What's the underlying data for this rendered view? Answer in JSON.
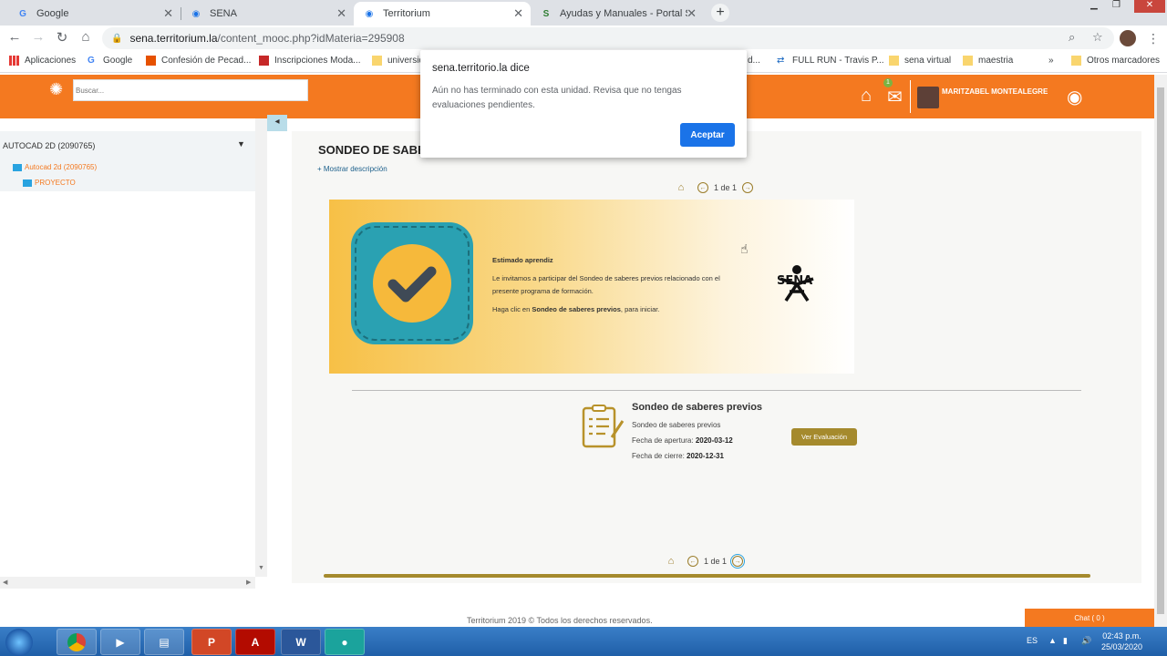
{
  "browser": {
    "tabs": [
      {
        "title": "Google",
        "icon": "google-icon"
      },
      {
        "title": "SENA",
        "icon": "territorium-eye-icon"
      },
      {
        "title": "Territorium",
        "icon": "territorium-eye-icon"
      },
      {
        "title": "Ayudas y Manuales - Portal SOFI",
        "icon": "sofia-icon"
      }
    ],
    "url_host": "sena.territorium.la",
    "url_path": "/content_mooc.php?idMateria=295908",
    "bookmarks": [
      "Aplicaciones",
      "Google",
      "Confesión de Pecad...",
      "Inscripciones Moda...",
      "universid",
      "d...",
      "FULL RUN - Travis P...",
      "sena virtual",
      "maestria",
      "»",
      "Otros marcadores"
    ]
  },
  "dialog": {
    "title": "sena.territorio.la dice",
    "message": "Aún no has terminado con esta unidad. Revisa que no tengas evaluaciones pendientes.",
    "ok_label": "Aceptar"
  },
  "header": {
    "search_placeholder": "Buscar...",
    "mail_badge": "1",
    "user_name": "MARITZABEL MONTEALEGRE"
  },
  "sidebar": {
    "course": "AUTOCAD 2D (2090765)",
    "items": [
      {
        "label": "Autocad 2d (2090765)"
      },
      {
        "label": "PROYECTO"
      }
    ]
  },
  "main": {
    "title": "SONDEO DE SABE",
    "show_description": "+ Mostrar descripción",
    "pager_text": "1 de 1",
    "banner": {
      "greeting": "Estimado aprendiz",
      "line1": "Le invitamos a participar del Sondeo de saberes previos relacionado con el presente programa de formación.",
      "line2_prefix": "Haga clic en ",
      "line2_bold": "Sondeo de saberes previos",
      "line2_suffix": ", para iniciar.",
      "logo_text": "SENA"
    },
    "evaluation": {
      "title": "Sondeo de saberes previos",
      "subtitle": "Sondeo de saberes previos",
      "open_label": "Fecha de apertura: ",
      "open_date": "2020-03-12",
      "close_label": "Fecha de cierre: ",
      "close_date": "2020-12-31",
      "button": "Ver Evaluación"
    }
  },
  "footer": {
    "text": "Territorium 2019 © Todos los derechos reservados.",
    "chat": "Chat ( 0 )"
  },
  "taskbar": {
    "lang": "ES",
    "time": "02:43 p.m.",
    "date": "25/03/2020"
  },
  "colors": {
    "brand_orange": "#f47920",
    "gold": "#a58a2d",
    "dialog_button": "#1a73e8"
  }
}
